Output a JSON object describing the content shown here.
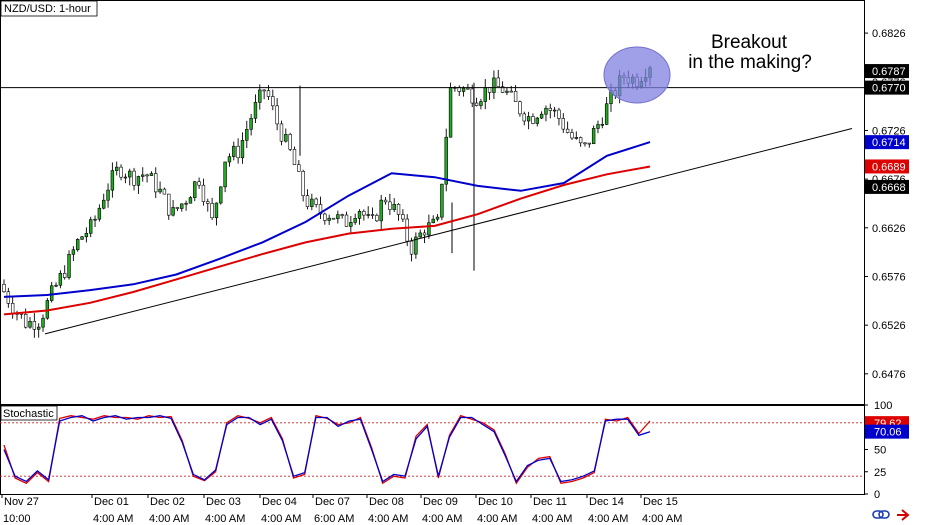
{
  "chart_data": [
    {
      "type": "candlestick",
      "title": "NZD/USD: 1-hour",
      "ylim": [
        0.6445,
        0.686
      ],
      "y_ticks": [
        "0.6826",
        "0.6776",
        "0.6726",
        "0.6676",
        "0.6626",
        "0.6576",
        "0.6526",
        "0.6476"
      ],
      "x_labels": [
        {
          "top": "Nov 27",
          "bottom": "10:00"
        },
        {
          "top": "Dec 01",
          "bottom": "4:00 AM"
        },
        {
          "top": "Dec 02",
          "bottom": "4:00 AM"
        },
        {
          "top": "Dec 03",
          "bottom": "4:00 AM"
        },
        {
          "top": "Dec 04",
          "bottom": "4:00 AM"
        },
        {
          "top": "Dec 07",
          "bottom": "6:00 AM"
        },
        {
          "top": "Dec 08",
          "bottom": "4:00 AM"
        },
        {
          "top": "Dec 09",
          "bottom": "4:00 AM"
        },
        {
          "top": "Dec 10",
          "bottom": "4:00 AM"
        },
        {
          "top": "Dec 11",
          "bottom": "4:00 AM"
        },
        {
          "top": "Dec 14",
          "bottom": "4:00 AM"
        },
        {
          "top": "Dec 15",
          "bottom": "4:00 AM"
        }
      ],
      "price_path": [
        0.6568,
        0.6545,
        0.6528,
        0.6531,
        0.656,
        0.6585,
        0.6615,
        0.6628,
        0.6665,
        0.6688,
        0.6678,
        0.6682,
        0.6665,
        0.664,
        0.6655,
        0.6678,
        0.6632,
        0.6698,
        0.6705,
        0.6742,
        0.677,
        0.673,
        0.67,
        0.6655,
        0.6642,
        0.664,
        0.663,
        0.6648,
        0.6628,
        0.6658,
        0.664,
        0.6605,
        0.6625,
        0.663,
        0.6772,
        0.6768,
        0.676,
        0.6772,
        0.6768,
        0.675,
        0.6738,
        0.6752,
        0.6742,
        0.672,
        0.6706,
        0.673,
        0.6757,
        0.6782,
        0.6778,
        0.6795
      ],
      "resistance_level": 0.677,
      "trendline": {
        "from": {
          "date": "Nov 27",
          "price": 0.6517
        },
        "to": {
          "date": "Dec 15",
          "price": 0.6728
        }
      },
      "moving_averages": [
        {
          "color": "#0000cc",
          "values": [
            0.6555,
            0.6557,
            0.6562,
            0.6568,
            0.6578,
            0.6594,
            0.6611,
            0.6632,
            0.6659,
            0.6682,
            0.6678,
            0.6669,
            0.6664,
            0.6672,
            0.67,
            0.6714
          ]
        },
        {
          "color": "#dd0000",
          "values": [
            0.6537,
            0.6541,
            0.6549,
            0.656,
            0.6573,
            0.6586,
            0.6599,
            0.6611,
            0.662,
            0.6625,
            0.6628,
            0.664,
            0.6656,
            0.667,
            0.6681,
            0.6689
          ]
        }
      ],
      "price_tags": [
        {
          "label": "0.6787",
          "bg": "#000000",
          "fg": "#ffffff"
        },
        {
          "label": "0.6770",
          "bg": "#000000",
          "fg": "#ffffff"
        },
        {
          "label": "0.6714",
          "bg": "#0000cc",
          "fg": "#ffffff"
        },
        {
          "label": "0.6689",
          "bg": "#dd0000",
          "fg": "#ffffff"
        },
        {
          "label": "0.6668",
          "bg": "#000000",
          "fg": "#ffffff"
        }
      ],
      "annotation": {
        "line1": "Breakout",
        "line2": "in the making?",
        "highlight_color": "#8080e0"
      },
      "colors": {
        "bull": "#22aa22",
        "bear": "#000000",
        "grid": "#000000"
      }
    },
    {
      "type": "line",
      "title": "Stochastic",
      "ylim": [
        0,
        100
      ],
      "y_ticks": [
        "100",
        "75",
        "50",
        "25",
        "0"
      ],
      "levels": [
        80,
        20
      ],
      "value_tags": [
        {
          "label": "79.62",
          "bg": "#dd0000",
          "fg": "#ffffff"
        },
        {
          "label": "70.06",
          "bg": "#0000cc",
          "fg": "#ffffff"
        }
      ],
      "series": [
        {
          "color": "#dd0000",
          "values": [
            55,
            18,
            12,
            24,
            14,
            85,
            88,
            86,
            84,
            88,
            86,
            86,
            84,
            88,
            86,
            87,
            60,
            20,
            15,
            25,
            80,
            88,
            85,
            80,
            86,
            62,
            18,
            22,
            88,
            85,
            78,
            80,
            86,
            52,
            12,
            20,
            18,
            65,
            78,
            18,
            66,
            88,
            84,
            80,
            72,
            45,
            12,
            30,
            40,
            42,
            12,
            14,
            18,
            24,
            84,
            82,
            86,
            68,
            82
          ]
        },
        {
          "color": "#0000cc",
          "values": [
            50,
            20,
            14,
            26,
            16,
            82,
            86,
            88,
            82,
            86,
            88,
            84,
            86,
            86,
            88,
            85,
            58,
            22,
            16,
            27,
            78,
            86,
            86,
            78,
            84,
            60,
            20,
            24,
            86,
            86,
            76,
            82,
            84,
            50,
            14,
            22,
            20,
            62,
            76,
            20,
            64,
            86,
            86,
            78,
            70,
            43,
            14,
            32,
            38,
            40,
            14,
            16,
            20,
            26,
            82,
            84,
            84,
            66,
            70
          ]
        }
      ]
    }
  ],
  "footer": {
    "icons": [
      "link-icon",
      "arrow-icon"
    ]
  }
}
